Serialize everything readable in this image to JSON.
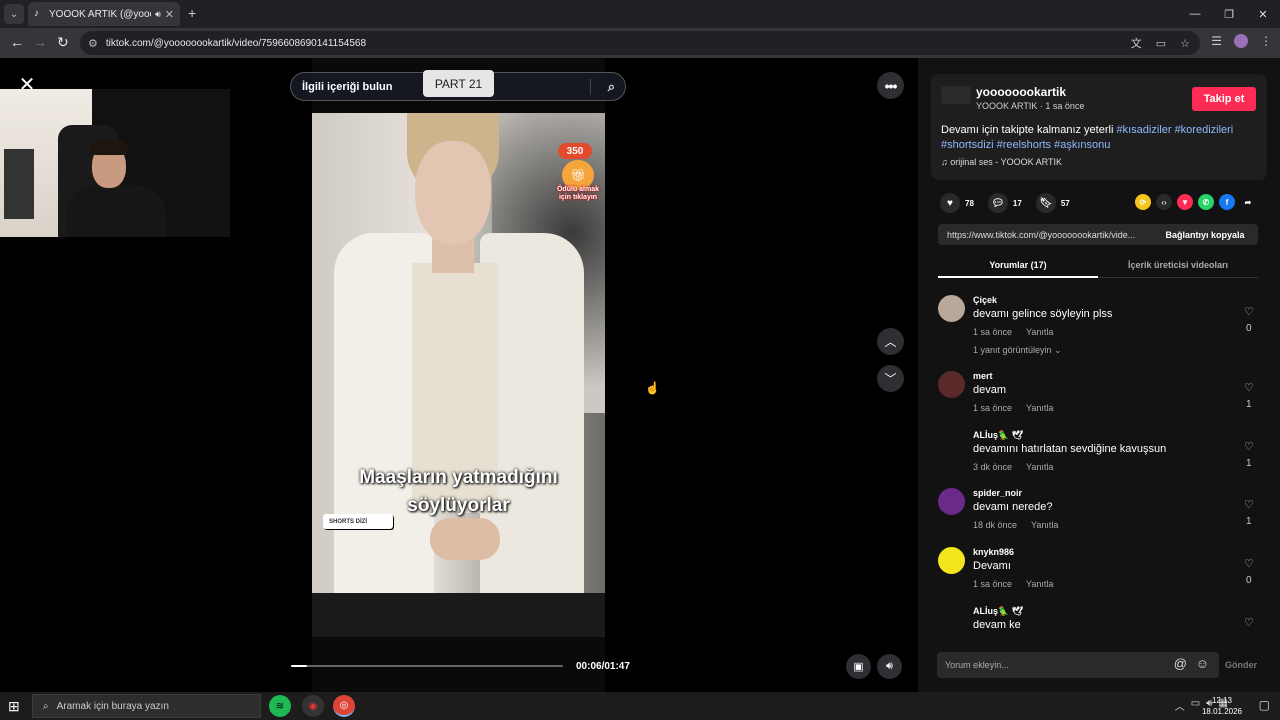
{
  "browser": {
    "tab_title": "YOOOK ARTIK (@yoooooo",
    "address": "tiktok.com/@yoooooookartik/video/7596608690141154568",
    "icons": [
      "tab-search-icon",
      "tiktok-favicon",
      "speaker-icon",
      "close-tab-icon",
      "new-tab-icon",
      "back-icon",
      "forward-icon",
      "reload-icon",
      "site-info-icon",
      "translate-icon",
      "cast-icon",
      "bookmark-star-icon",
      "reading-list-icon",
      "profile-icon",
      "kebab-menu-icon"
    ]
  },
  "player": {
    "search_placeholder": "İlgili içeriği bulun",
    "part_tag": "PART 21",
    "subtitle_line1": "Maaşların yatmadığını",
    "subtitle_line2": "söylüyorlar",
    "badge": "350",
    "gift_text": "Ödülü almak için tıklayın",
    "shorts_logo": "SHORTS DİZİ",
    "time": "00:06/01:47",
    "progress": 0.057
  },
  "creator": {
    "username": "yoooooookartik",
    "subline": "YOOOK ARTIK · 1 sa önce",
    "follow": "Takip et",
    "desc_text": "Devamı için takipte kalmanız yeterli",
    "hashtags": [
      "#kısadiziler",
      "#koredizileri",
      "#shortsdizi",
      "#reelshorts",
      "#aşkınsonu"
    ],
    "music": "orijinal ses - YOOOK ARTIK"
  },
  "actions": {
    "likes": "78",
    "comments": "17",
    "saves": "57"
  },
  "link": {
    "url": "https://www.tiktok.com/@yoooooookartik/vide...",
    "copy": "Bağlantıyı kopyala"
  },
  "tabs": {
    "comments": "Yorumlar (17)",
    "creator_videos": "İçerik üreticisi videoları"
  },
  "comments": [
    {
      "user": "Çiçek",
      "text": "devamı gelince söyleyin plss",
      "time": "1 sa önce",
      "reply": "Yanıtla",
      "likes": "0",
      "more": "1 yanıt görüntüleyin ⌄",
      "color": "#b9a79a"
    },
    {
      "user": "mert",
      "text": "devam",
      "time": "1 sa önce",
      "reply": "Yanıtla",
      "likes": "1",
      "more": "",
      "color": "#5a2a2a"
    },
    {
      "user": "ALİuş🦜 🕊",
      "text": "devamını hatırlatan sevdiğine kavuşsun",
      "time": "3 dk önce",
      "reply": "Yanıtla",
      "likes": "1",
      "more": "",
      "color": "#121212"
    },
    {
      "user": "spider_noir",
      "text": "devamı nerede?",
      "time": "18 dk önce",
      "reply": "Yanıtla",
      "likes": "1",
      "more": "",
      "color": "#6a2a8a"
    },
    {
      "user": "knykn986",
      "text": "Devamı",
      "time": "1 sa önce",
      "reply": "Yanıtla",
      "likes": "0",
      "more": "",
      "color": "#f2e51b"
    },
    {
      "user": "ALİuş🦜 🕊",
      "text": "devam ke",
      "time": "",
      "reply": "",
      "likes": "",
      "more": "",
      "color": "#121212"
    }
  ],
  "comment_input": {
    "placeholder": "Yorum ekleyin...",
    "send": "Gönder"
  },
  "taskbar": {
    "search": "Aramak için buraya yazın",
    "time": "12:13",
    "date": "18.01.2026"
  },
  "colors": {
    "accent": "#fe2c55",
    "hashtag": "#8fb8ff",
    "panel": "#121212"
  }
}
